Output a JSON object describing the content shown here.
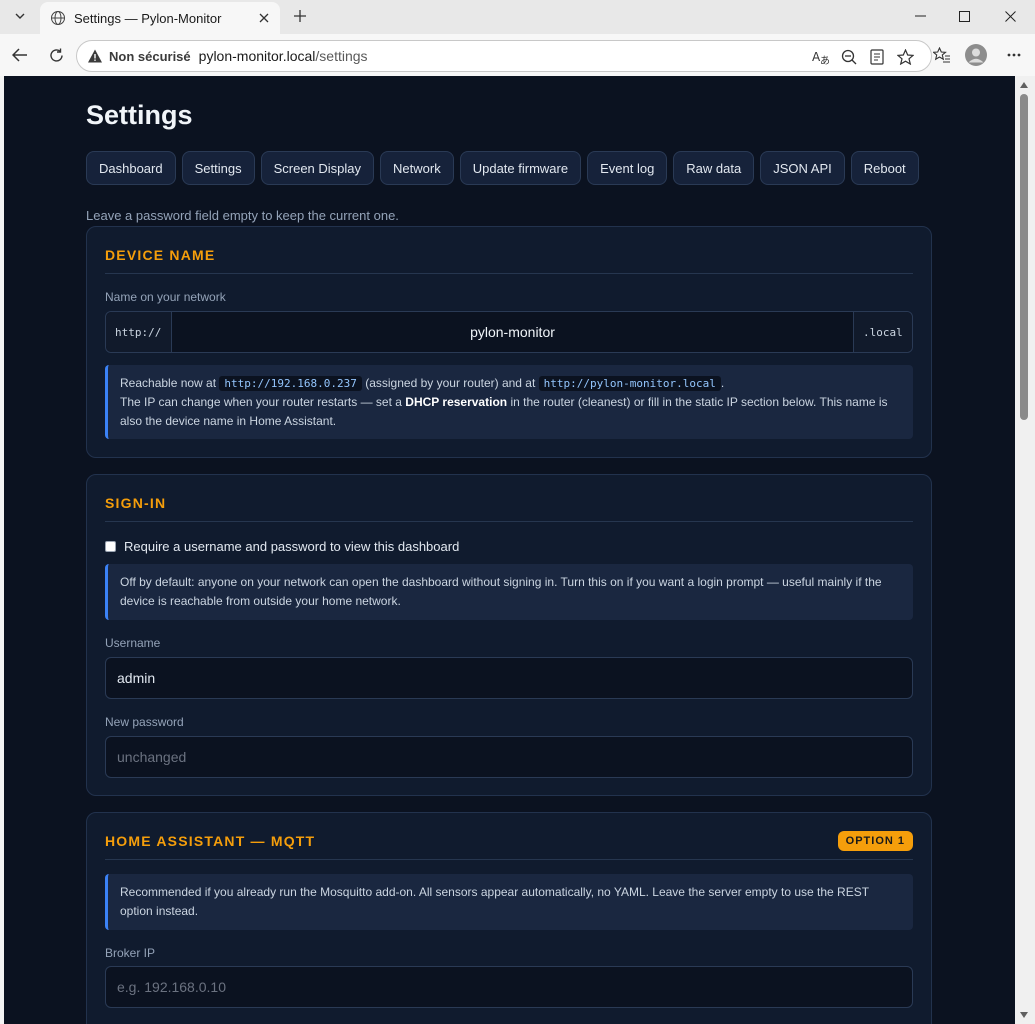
{
  "browser": {
    "tab_title": "Settings — Pylon-Monitor",
    "security_label": "Non sécurisé",
    "url_host": "pylon-monitor.local",
    "url_path": "/settings"
  },
  "page": {
    "title": "Settings",
    "nav": [
      "Dashboard",
      "Settings",
      "Screen Display",
      "Network",
      "Update firmware",
      "Event log",
      "Raw data",
      "JSON API",
      "Reboot"
    ],
    "hint": "Leave a password field empty to keep the current one."
  },
  "device_name": {
    "title": "DEVICE NAME",
    "label": "Name on your network",
    "prefix": "http://",
    "value": "pylon-monitor",
    "suffix": ".local",
    "info_reachable": "Reachable now at",
    "info_ip": "http://192.168.0.237",
    "info_mid": "(assigned by your router) and at",
    "info_host": "http://pylon-monitor.local",
    "info_end": ".",
    "info_line2a": "The IP can change when your router restarts — set a",
    "info_bold": "DHCP reservation",
    "info_line2b": "in the router (cleanest) or fill in the static IP section below. This name is also the device name in Home Assistant."
  },
  "sign_in": {
    "title": "SIGN-IN",
    "checkbox_label": "Require a username and password to view this dashboard",
    "info": "Off by default: anyone on your network can open the dashboard without signing in. Turn this on if you want a login prompt — useful mainly if the device is reachable from outside your home network.",
    "username_label": "Username",
    "username_value": "admin",
    "password_label": "New password",
    "password_placeholder": "unchanged"
  },
  "mqtt": {
    "title": "HOME ASSISTANT — MQTT",
    "badge": "OPTION 1",
    "info": "Recommended if you already run the Mosquitto add-on. All sensors appear automatically, no YAML. Leave the server empty to use the REST option instead.",
    "broker_label": "Broker IP",
    "broker_placeholder": "e.g. 192.168.0.10"
  },
  "colors": {
    "accent": "#f59e0b",
    "page_bg": "#0b1220",
    "card_bg": "#101b2e",
    "info_border": "#3b82f6"
  }
}
